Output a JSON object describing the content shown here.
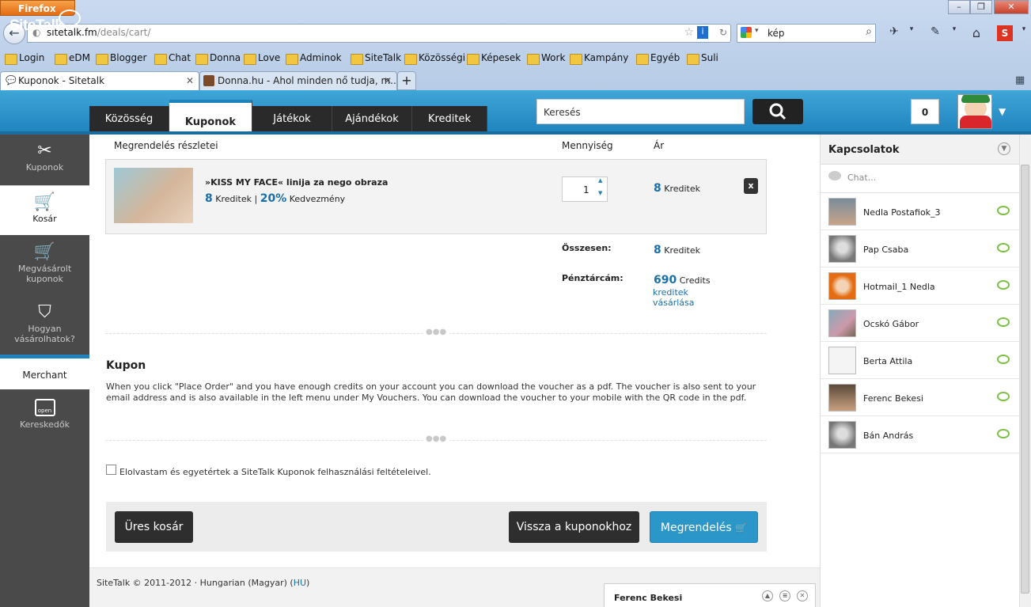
{
  "browser": {
    "firefox_label": "Firefox",
    "url_host": "sitetalk.fm",
    "url_path": "/deals/cart/",
    "search_value": "kép",
    "bookmarks": [
      "Login",
      "eDM",
      "Blogger",
      "Chat",
      "Donna",
      "Love",
      "Adminok",
      "SiteTalk",
      "Közösségi",
      "Képesek",
      "Work",
      "Kampány",
      "Egyéb",
      "Suli"
    ],
    "tabs": [
      {
        "label": "Kuponok - Sitetalk"
      },
      {
        "label": "Donna.hu - Ahol minden nő tudja, m..."
      }
    ],
    "new_tab": "+"
  },
  "site": {
    "logo": "SiteTalk",
    "menu": [
      "Közösség",
      "Kuponok",
      "Játékok",
      "Ajándékok",
      "Kreditek"
    ],
    "search_placeholder": "Keresés",
    "notifications": "0"
  },
  "leftnav": [
    {
      "label": "Kuponok",
      "icon": "scissors-icon"
    },
    {
      "label": "Kosár",
      "icon": "cart-icon"
    },
    {
      "label": "Megvásárolt kuponok",
      "icon": "cart-icon"
    },
    {
      "label": "Hogyan vásárolhatok?",
      "icon": "shield-icon"
    },
    {
      "label": "Merchant"
    },
    {
      "label": "Kereskedők",
      "icon": "open-sign-icon",
      "icon_text": "open"
    }
  ],
  "cart": {
    "headers": {
      "details": "Megrendelés részletei",
      "quantity": "Mennyiség",
      "price": "Ár"
    },
    "item": {
      "title": "»KISS MY FACE« linija za nego obraza",
      "credits": "8",
      "credits_unit": "Kreditek",
      "separator": "|",
      "discount": "20%",
      "discount_label": "Kedvezmény",
      "quantity": "1",
      "price": "8",
      "price_unit": "Kreditek",
      "remove": "x"
    },
    "total_label": "Összesen:",
    "total_value": "8",
    "total_unit": "Kreditek",
    "wallet_label": "Pénztárcám:",
    "wallet_value": "690",
    "wallet_unit": "Credits",
    "buy_link_1": "kreditek",
    "buy_link_2": "vásárlása"
  },
  "coupon": {
    "title": "Kupon",
    "text": "When you click \"Place Order\" and you have enough credits on your account you can download the voucher as a pdf. The voucher is also sent to your email address and is also available in the left menu under My Vouchers. You can download the voucher to your mobile with the QR code in the pdf."
  },
  "agree_text": "Elolvastam és egyetértek a SiteTalk Kuponok felhasználási feltételeivel.",
  "buttons": {
    "empty": "Üres kosár",
    "back": "Vissza a kuponokhoz",
    "order": "Megrendelés"
  },
  "footer": {
    "prefix": "SiteTalk © 2011-2012 · Hungarian (Magyar) (",
    "lang": "HU",
    "suffix": ")"
  },
  "contacts": {
    "title": "Kapcsolatok",
    "chat_placeholder": "Chat...",
    "list": [
      "Nedla Postafiok_3",
      "Pap Csaba",
      "Hotmail_1 Nedla",
      "Ocskó Gábor",
      "Berta Attila",
      "Ferenc Bekesi",
      "Bán András"
    ]
  },
  "chat_window": {
    "name": "Ferenc Bekesi"
  },
  "colors": {
    "brand": "#1e82bd",
    "accent_green": "#7bc043",
    "dark_button": "#2e2e2e"
  }
}
